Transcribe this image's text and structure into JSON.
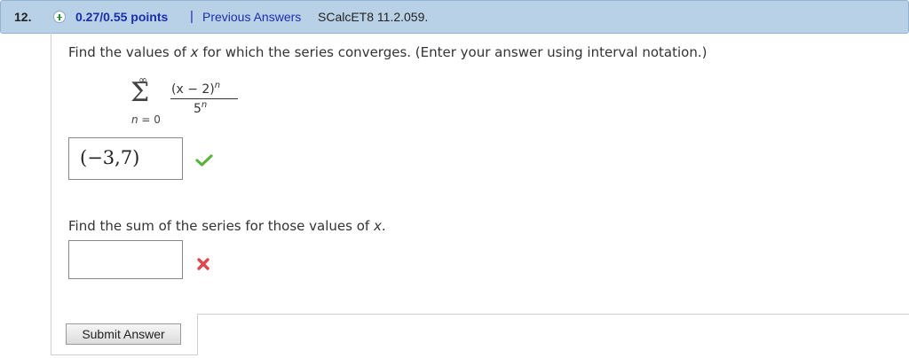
{
  "header": {
    "question_number": "12.",
    "points": "0.27/0.55 points",
    "separator": "|",
    "previous_answers": "Previous Answers",
    "problem_code": "SCalcET8 11.2.059."
  },
  "question1": {
    "text_before": "Find the values of ",
    "var": "x",
    "text_after": " for which the series converges. (Enter your answer using interval notation.)"
  },
  "series": {
    "sigma": "Σ",
    "upper": "∞",
    "lower_var": "n",
    "lower_rest": " = 0",
    "numerator": "(x − 2)",
    "numerator_exp": "n",
    "denominator": "5",
    "denominator_exp": "n"
  },
  "answer1": {
    "value": "(−3,7)",
    "status": "correct",
    "status_color": "#5ab43c"
  },
  "question2": {
    "text_before": "Find the sum of the series for those values of ",
    "var": "x",
    "text_after": "."
  },
  "answer2": {
    "value": "",
    "status": "incorrect",
    "status_color": "#e0474c"
  },
  "submit": {
    "label": "Submit Answer"
  }
}
